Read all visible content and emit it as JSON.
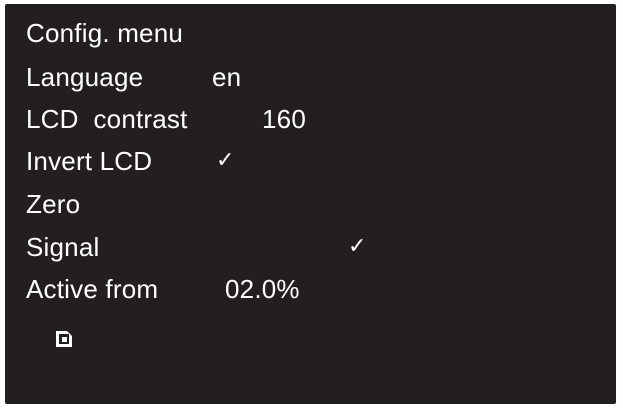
{
  "menu": {
    "title": "Config. menu",
    "items": [
      {
        "label": "Language",
        "value": "en"
      },
      {
        "label": "LCD  contrast",
        "value": "160"
      },
      {
        "label": "Invert LCD",
        "value": "✓"
      },
      {
        "label": "Zero",
        "value": ""
      },
      {
        "label": "Signal",
        "value": "✓"
      },
      {
        "label": "Active from",
        "value": "02.0%"
      }
    ],
    "save_icon": "save-icon"
  },
  "colors": {
    "screen_background": "#231f20",
    "text": "#ffffff"
  }
}
